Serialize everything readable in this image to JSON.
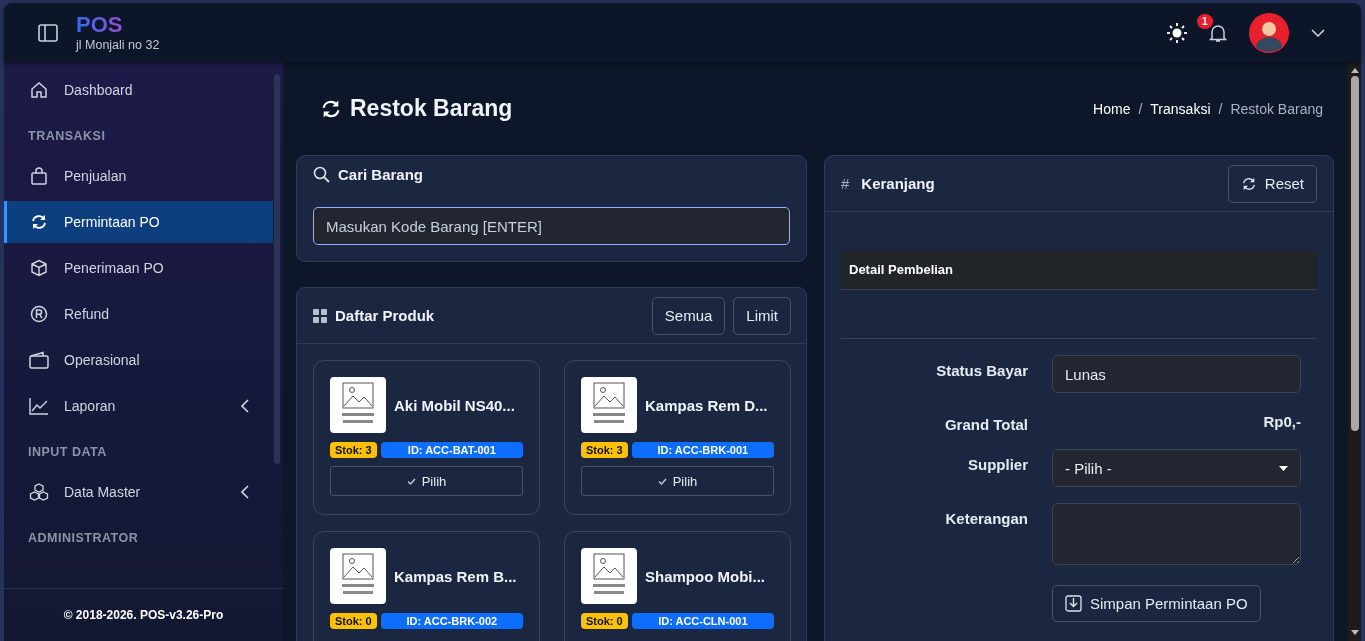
{
  "header": {
    "logo": "POS",
    "address": "jl Monjali no 32",
    "notifications": "1"
  },
  "sidebar": {
    "items": [
      {
        "kind": "item",
        "label": "Dashboard",
        "selected": false
      },
      {
        "kind": "section",
        "label": "TRANSAKSI"
      },
      {
        "kind": "item",
        "label": "Penjualan",
        "selected": false
      },
      {
        "kind": "item",
        "label": "Permintaan PO",
        "selected": true
      },
      {
        "kind": "item",
        "label": "Penerimaan PO",
        "selected": false
      },
      {
        "kind": "item",
        "label": "Refund",
        "selected": false
      },
      {
        "kind": "item",
        "label": "Operasional",
        "selected": false
      },
      {
        "kind": "item",
        "label": "Laporan",
        "selected": false,
        "expanded": false
      },
      {
        "kind": "section",
        "label": "INPUT DATA"
      },
      {
        "kind": "item",
        "label": "Data Master",
        "selected": false,
        "expanded": false
      },
      {
        "kind": "section",
        "label": "ADMINISTRATOR"
      }
    ],
    "footer": "© 2018-2026. POS-v3.26-Pro"
  },
  "page": {
    "title": "Restok Barang",
    "breadcrumb_separator": "/",
    "breadcrumb": [
      {
        "label": "Home",
        "current": false
      },
      {
        "label": "Transaksi",
        "current": false
      },
      {
        "label": "Restok Barang",
        "current": true
      }
    ]
  },
  "search": {
    "title": "Cari Barang",
    "placeholder": "Masukan Kode Barang [ENTER]"
  },
  "products": {
    "title": "Daftar Produk",
    "buttons": [
      "Semua",
      "Limit"
    ],
    "items": [
      {
        "name": "Aki Mobil NS40...",
        "stock": "Stok: 3",
        "id": "ID: ACC-BAT-001",
        "button": "Pilih"
      },
      {
        "name": "Kampas Rem D...",
        "stock": "Stok: 3",
        "id": "ID: ACC-BRK-001",
        "button": "Pilih"
      },
      {
        "name": "Kampas Rem B...",
        "stock": "Stok: 0",
        "id": "ID: ACC-BRK-002"
      },
      {
        "name": "Shampoo Mobi...",
        "stock": "Stok: 0",
        "id": "ID: ACC-CLN-001"
      }
    ]
  },
  "cart": {
    "symbol": "#",
    "title": "Keranjang",
    "reset": "Reset",
    "table_header": "Detail Pembelian",
    "fields": [
      {
        "kind": "input",
        "label": "Status Bayar",
        "value": "Lunas"
      },
      {
        "kind": "total",
        "label": "Grand Total",
        "value": "Rp0,-"
      },
      {
        "kind": "select",
        "label": "Supplier",
        "value": "- Pilih -"
      },
      {
        "kind": "textarea",
        "label": "Keterangan"
      }
    ],
    "submit": "Simpan Permintaan PO"
  }
}
